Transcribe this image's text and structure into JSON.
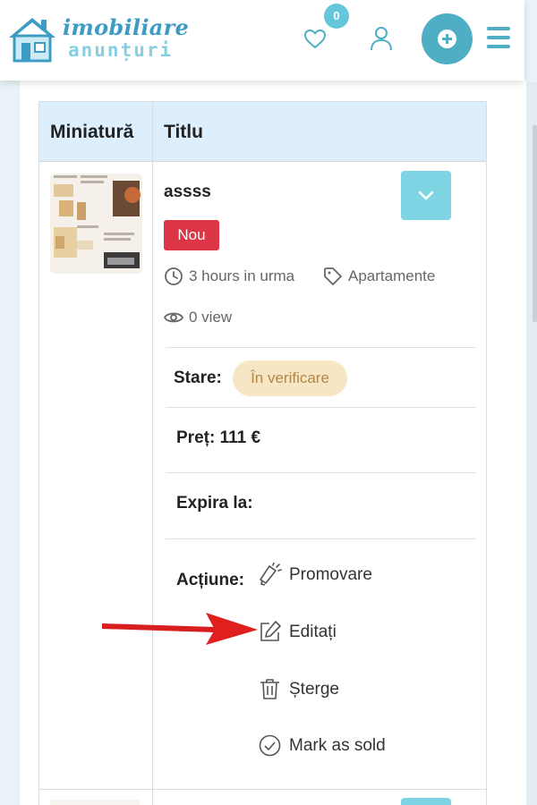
{
  "header": {
    "logo_line1": "imobiliare",
    "logo_line2": "anunțuri",
    "favorites_count": "0",
    "accent_color": "#4eaec3"
  },
  "table": {
    "col_thumb": "Miniatură",
    "col_title": "Titlu"
  },
  "listing": {
    "title": "assss",
    "badge": "Nou",
    "time": "3 hours in urma",
    "category": "Apartamente",
    "views": "0 view",
    "status_label": "Stare:",
    "status_value": "În verificare",
    "price_label": "Preț: 111 €",
    "expires_label": "Expira la:",
    "actions_label": "Acțiune:",
    "actions": [
      {
        "label": "Promovare",
        "icon": "megaphone-icon"
      },
      {
        "label": "Editați",
        "icon": "edit-icon"
      },
      {
        "label": "Șterge",
        "icon": "trash-icon"
      },
      {
        "label": "Mark as sold",
        "icon": "check-circle-icon"
      }
    ]
  },
  "colors": {
    "badge_red": "#dc3545",
    "status_pill": "#f6e6c3",
    "header_row": "#ddeefc",
    "arrow_red": "#e0201f"
  }
}
